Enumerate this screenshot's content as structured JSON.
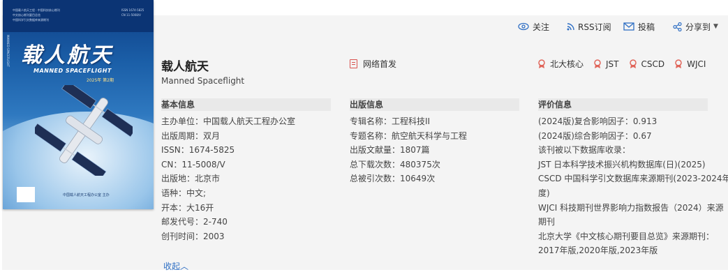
{
  "cover": {
    "title_cn": "载人航天",
    "title_en": "MANNED SPACEFLIGHT",
    "issue": "2025年 第2期",
    "issn_line": "ISSN 1674-5825",
    "cn_line": "CN 11-5008/V",
    "publisher": "中国载人航天工程办公室 主办"
  },
  "toolbar": {
    "follow": "关注",
    "rss": "RSS订阅",
    "submit": "投稿",
    "share": "分享到"
  },
  "journal": {
    "title_cn": "载人航天",
    "title_en": "Manned Spaceflight",
    "online_first": "网络首发"
  },
  "badges": [
    "北大核心",
    "JST",
    "CSCD",
    "WJCI"
  ],
  "basic": {
    "header": "基本信息",
    "rows": [
      {
        "k": "主办单位：",
        "v": "中国载人航天工程办公室"
      },
      {
        "k": "出版周期：",
        "v": "双月"
      },
      {
        "k": "ISSN：",
        "v": "1674-5825"
      },
      {
        "k": "CN：",
        "v": "11-5008/V"
      },
      {
        "k": "出版地：",
        "v": "北京市"
      },
      {
        "k": "语种：",
        "v": "中文;"
      },
      {
        "k": "开本：",
        "v": "大16开"
      },
      {
        "k": "邮发代号：",
        "v": "2-740"
      },
      {
        "k": "创刊时间：",
        "v": "2003"
      }
    ]
  },
  "publish": {
    "header": "出版信息",
    "rows": [
      {
        "k": "专辑名称：",
        "v": "工程科技II"
      },
      {
        "k": "专题名称：",
        "v": "航空航天科学与工程"
      },
      {
        "k": "出版文献量：",
        "v": "1807篇"
      },
      {
        "k": "总下载次数：",
        "v": "480375次"
      },
      {
        "k": "总被引次数：",
        "v": "10649次"
      }
    ]
  },
  "evaluation": {
    "header": "评价信息",
    "lines": [
      "(2024版)复合影响因子：0.913",
      "(2024版)综合影响因子：0.67",
      "该刊被以下数据库收录：",
      "JST 日本科学技术振兴机构数据库(日)(2025)",
      "CSCD 中国科学引文数据库来源期刊(2023-2024年",
      "度)",
      "WJCI 科技期刊世界影响力指数报告（2024）来源",
      "期刊",
      "北京大学《中文核心期刊要目总览》来源期刊：",
      "2017年版,2020年版,2023年版"
    ]
  },
  "collapse": "收起"
}
